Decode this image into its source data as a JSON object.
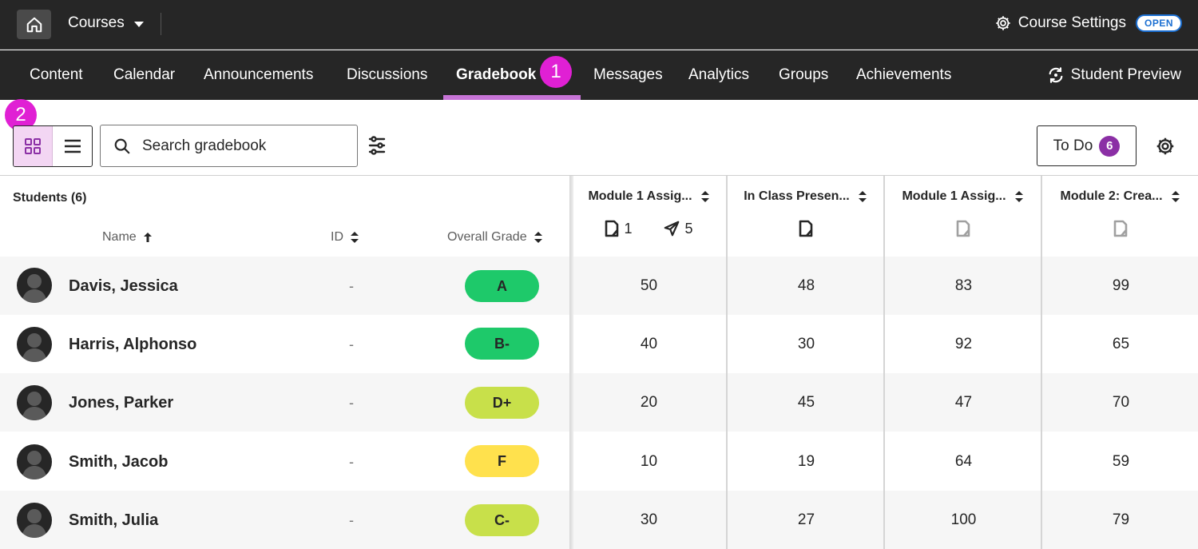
{
  "topbar": {
    "courses_label": "Courses",
    "course_settings_label": "Course Settings",
    "status_badge": "OPEN"
  },
  "nav": {
    "tabs": [
      {
        "label": "Content"
      },
      {
        "label": "Calendar"
      },
      {
        "label": "Announcements"
      },
      {
        "label": "Discussions"
      },
      {
        "label": "Gradebook",
        "active": true
      },
      {
        "label": "Messages"
      },
      {
        "label": "Analytics"
      },
      {
        "label": "Groups"
      },
      {
        "label": "Achievements"
      }
    ],
    "student_preview_label": "Student Preview"
  },
  "callouts": [
    "1",
    "2"
  ],
  "toolbar": {
    "search_placeholder": "Search gradebook",
    "todo_label": "To Do",
    "todo_count": "6"
  },
  "table": {
    "students_label": "Students (6)",
    "columns": {
      "name": "Name",
      "id": "ID",
      "overall": "Overall Grade"
    },
    "grade_columns": [
      {
        "title": "Module 1 Assig...",
        "submissions": "1",
        "sent": "5"
      },
      {
        "title": "In Class Presen..."
      },
      {
        "title": "Module 1 Assig..."
      },
      {
        "title": "Module 2: Crea..."
      }
    ],
    "rows": [
      {
        "name": "Davis, Jessica",
        "id": "-",
        "overall": "A",
        "grade_color": "#1ec96a",
        "scores": [
          "50",
          "48",
          "83",
          "99"
        ]
      },
      {
        "name": "Harris, Alphonso",
        "id": "-",
        "overall": "B-",
        "grade_color": "#1ec96a",
        "scores": [
          "40",
          "30",
          "92",
          "65"
        ]
      },
      {
        "name": "Jones, Parker",
        "id": "-",
        "overall": "D+",
        "grade_color": "#c8e04a",
        "scores": [
          "20",
          "45",
          "47",
          "70"
        ]
      },
      {
        "name": "Smith, Jacob",
        "id": "-",
        "overall": "F",
        "grade_color": "#ffe14d",
        "scores": [
          "10",
          "19",
          "64",
          "59"
        ]
      },
      {
        "name": "Smith, Julia",
        "id": "-",
        "overall": "C-",
        "grade_color": "#c8e04a",
        "scores": [
          "30",
          "27",
          "100",
          "79"
        ]
      }
    ]
  }
}
